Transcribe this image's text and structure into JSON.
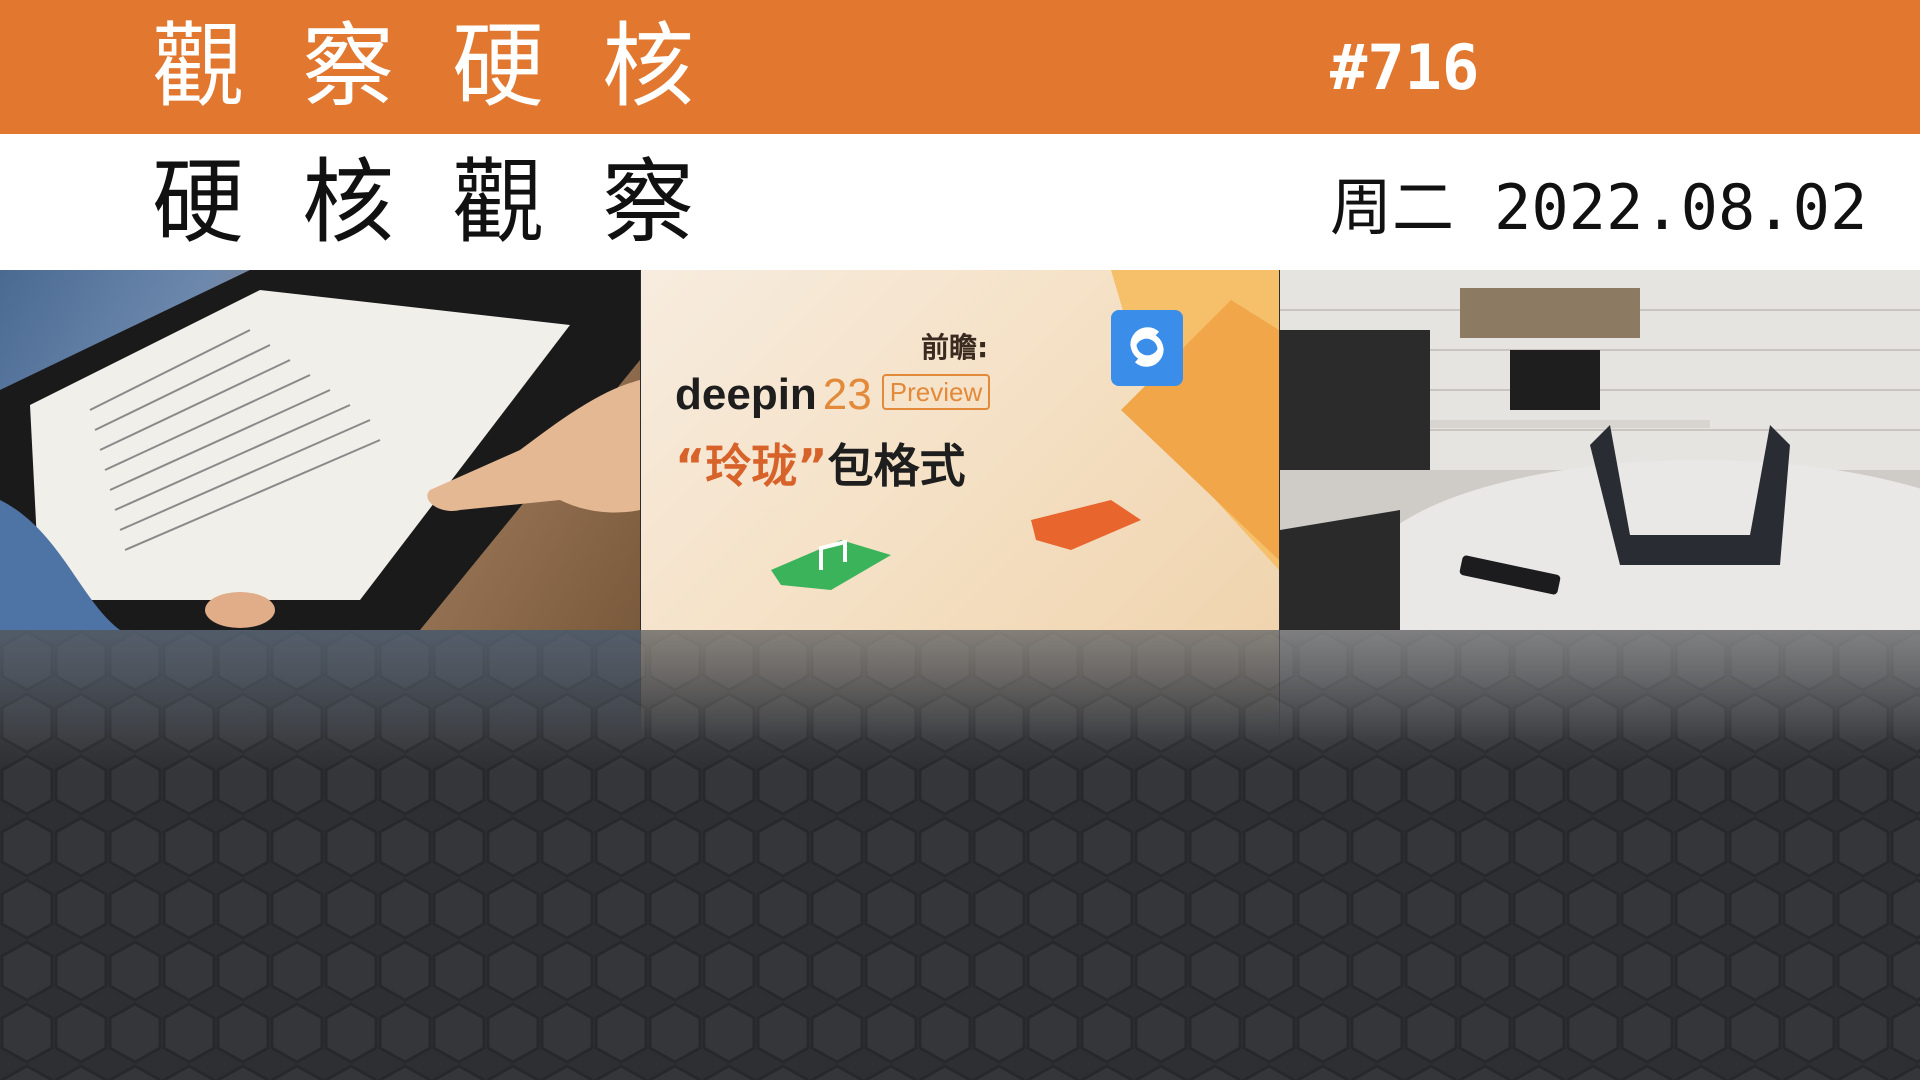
{
  "header": {
    "title_top": "觀察硬核",
    "issue": "#716",
    "title_bottom": "硬核觀察",
    "weekday": "周二",
    "date": "2022.08.02"
  },
  "panels": {
    "deepin": {
      "preview_label": "前瞻:",
      "brand": "deepin",
      "version": "23",
      "badge": "Preview",
      "headline_quoted": "“玲珑”",
      "headline_rest": "包格式"
    }
  },
  "colors": {
    "header_bar": "#e2782f",
    "accent": "#e28a3a",
    "background": "#2d2f33"
  },
  "icons": [
    "refresh-icon",
    "music-note-icon",
    "envelope-icon",
    "package-icon"
  ]
}
